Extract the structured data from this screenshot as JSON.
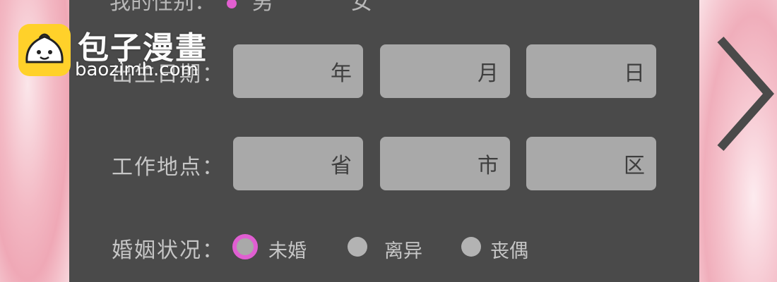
{
  "watermark": {
    "title": "包子漫畫",
    "url": "baozimh.com"
  },
  "form": {
    "gender_row_cut": {
      "label": "我的性别：",
      "opt1": "男",
      "opt2": "女"
    },
    "birth": {
      "label": "出生日期：",
      "year": "年",
      "month": "月",
      "day": "日"
    },
    "work": {
      "label": "工作地点：",
      "province": "省",
      "city": "市",
      "district": "区"
    },
    "marital": {
      "label": "婚姻状况：",
      "options": [
        "未婚",
        "离异",
        "丧偶"
      ],
      "selected": "未婚"
    }
  },
  "colors": {
    "accent_radio": "#e05fd2",
    "panel": "#4a4a4a",
    "field": "#a9a9a9",
    "logo": "#ffd12a"
  },
  "icons": {
    "next": "chevron-right-icon",
    "logo": "bun-face-icon"
  }
}
